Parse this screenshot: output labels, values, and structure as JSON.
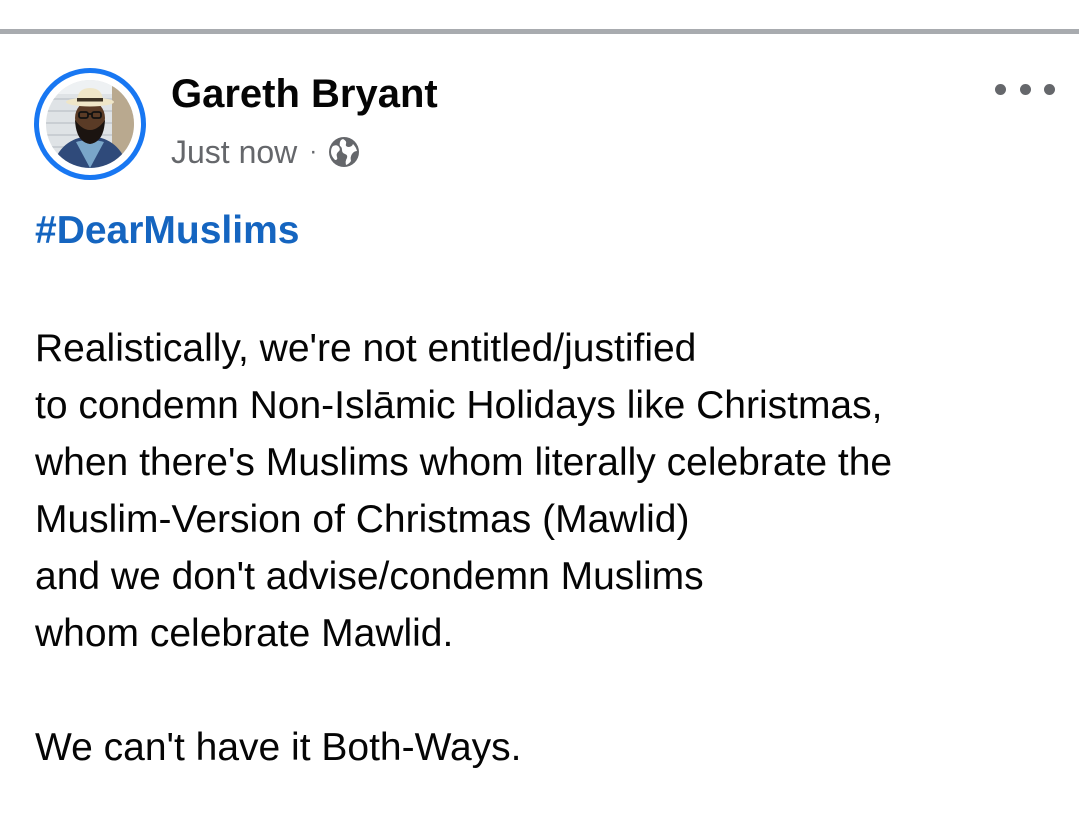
{
  "post": {
    "author": {
      "name": "Gareth Bryant",
      "avatar_icon": "user-avatar-photo"
    },
    "meta": {
      "timestamp": "Just now",
      "separator": "·",
      "privacy_icon": "globe-icon"
    },
    "more_icon": "more-options-icon",
    "hashtag": "#DearMuslims",
    "body_lines": [
      "Realistically, we're not entitled/justified",
      "to condemn Non-Islāmic Holidays like Christmas,",
      "when there's Muslims whom literally celebrate the",
      "Muslim-Version of Christmas (Mawlid)",
      "and we don't advise/condemn Muslims",
      "whom celebrate Mawlid."
    ],
    "closing_line": "We can't have it Both-Ways."
  },
  "colors": {
    "accent": "#1877f2",
    "hashtag": "#1565c0",
    "secondary_text": "#65676b",
    "primary_text": "#050505",
    "divider": "#a8abaf"
  }
}
